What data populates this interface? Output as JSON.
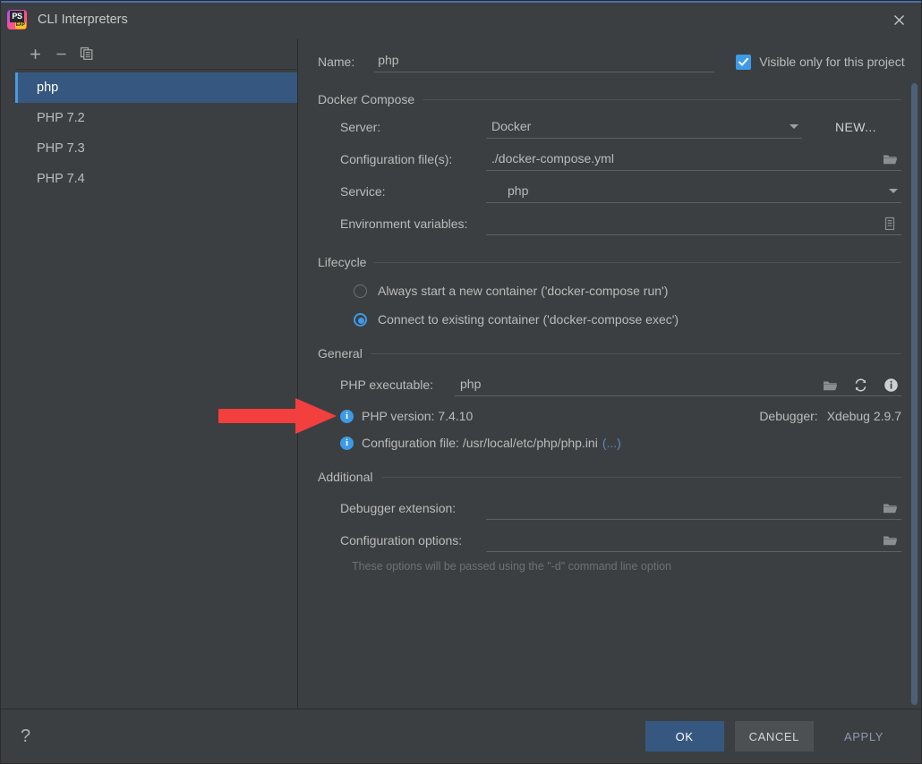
{
  "window": {
    "title": "CLI Interpreters",
    "app_icon": "phpstorm-icon",
    "close_icon": "close-icon"
  },
  "left_panel": {
    "toolbar": [
      {
        "name": "add-interpreter-button",
        "icon": "plus-icon"
      },
      {
        "name": "remove-interpreter-button",
        "icon": "minus-icon"
      },
      {
        "name": "copy-interpreter-button",
        "icon": "copy-icon"
      }
    ],
    "items": [
      {
        "label": "php",
        "selected": true
      },
      {
        "label": "PHP 7.2",
        "selected": false
      },
      {
        "label": "PHP 7.3",
        "selected": false
      },
      {
        "label": "PHP 7.4",
        "selected": false
      }
    ]
  },
  "form": {
    "name_label": "Name:",
    "name_value": "php",
    "visible_only_label": "Visible only for this project",
    "visible_only_checked": true,
    "docker_compose_section": "Docker Compose",
    "server_label": "Server:",
    "server_value": "Docker",
    "new_button": "NEW...",
    "config_files_label": "Configuration file(s):",
    "config_files_value": "./docker-compose.yml",
    "service_label": "Service:",
    "service_value": "php",
    "env_vars_label": "Environment variables:",
    "env_vars_value": "",
    "lifecycle_section": "Lifecycle",
    "lifecycle_options": [
      {
        "label": "Always start a new container ('docker-compose run')",
        "selected": false
      },
      {
        "label": "Connect to existing container ('docker-compose exec')",
        "selected": true
      }
    ],
    "general_section": "General",
    "php_executable_label": "PHP executable:",
    "php_executable_value": "php",
    "php_version_text": "PHP version: 7.4.10",
    "debugger_label": "Debugger:",
    "debugger_value": "Xdebug 2.9.7",
    "configuration_file_text": "Configuration file: /usr/local/etc/php/php.ini",
    "configuration_file_link": "(...)",
    "additional_section": "Additional",
    "debugger_extension_label": "Debugger extension:",
    "debugger_extension_value": "",
    "configuration_options_label": "Configuration options:",
    "configuration_options_value": "",
    "configuration_options_hint": "These options will be passed using the \"-d\" command line option"
  },
  "footer": {
    "help_label": "?",
    "ok_label": "OK",
    "cancel_label": "CANCEL",
    "apply_label": "APPLY"
  },
  "annotation": {
    "arrow_color": "#f43f3f",
    "points_to": "connect-to-existing-container-radio"
  },
  "colors": {
    "window_bg": "#3c3f41",
    "selection_blue": "#365880",
    "accent_blue": "#3d9ae8",
    "link_blue": "#5c87c4",
    "arrow_red": "#f43f3f"
  }
}
